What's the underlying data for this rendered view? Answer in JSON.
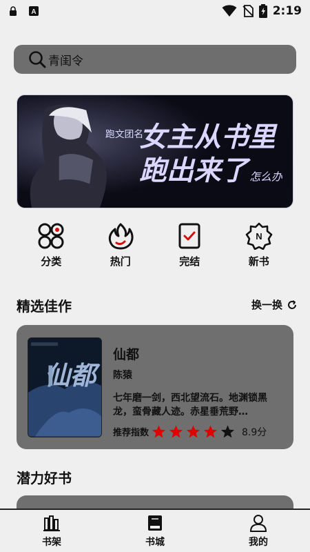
{
  "status_bar": {
    "time": "2:19",
    "icons": [
      "lock-icon",
      "a-badge-icon",
      "wifi-icon",
      "no-sim-icon",
      "battery-icon"
    ]
  },
  "search": {
    "placeholder": "青闺令",
    "icon": "search-icon"
  },
  "banner": {
    "title": "女主从书里跑出来了怎么办",
    "prefix": "跑文团名"
  },
  "categories": [
    {
      "label": "分类",
      "icon": "category-grid-icon"
    },
    {
      "label": "热门",
      "icon": "flame-icon"
    },
    {
      "label": "完结",
      "icon": "checklist-icon"
    },
    {
      "label": "新书",
      "icon": "new-badge-icon"
    }
  ],
  "featured": {
    "section_title": "精选佳作",
    "swap_label": "换一换",
    "book": {
      "title": "仙都",
      "author": "陈猿",
      "description": "七年磨一剑，西北望流石。地渊锁黑龙，蛮骨藏人迹。赤星垂荒野…",
      "rating_label": "推荐指数",
      "rating_stars": 4,
      "score": "8.9分",
      "cover_text": "仙都"
    }
  },
  "potential": {
    "section_title": "潜力好书"
  },
  "bottom_nav": [
    {
      "label": "书架",
      "icon": "bookshelf-icon"
    },
    {
      "label": "书城",
      "icon": "book-store-icon"
    },
    {
      "label": "我的",
      "icon": "user-icon"
    }
  ],
  "colors": {
    "background": "#efefef",
    "card": "#6f6f6f",
    "star_filled": "#e00000",
    "star_empty": "#111111"
  }
}
